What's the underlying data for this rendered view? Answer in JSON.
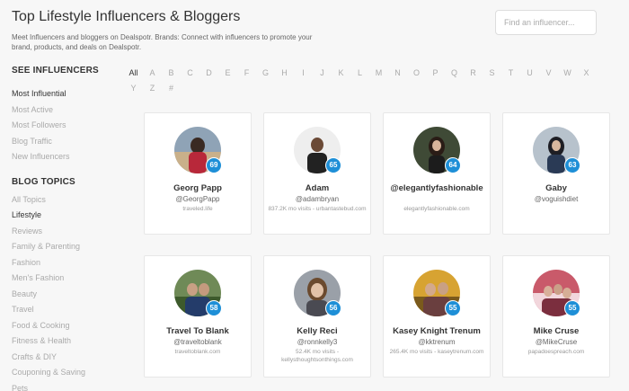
{
  "header": {
    "title": "Top Lifestyle Influencers & Bloggers",
    "description": "Meet Influencers and bloggers on Dealspotr. Brands: Connect with influencers to promote your brand, products, and deals on Dealspotr."
  },
  "search": {
    "placeholder": "Find an influencer..."
  },
  "sidebar": {
    "see_heading": "SEE INFLUENCERS",
    "filters": [
      {
        "label": "Most Influential",
        "active": true
      },
      {
        "label": "Most Active",
        "active": false
      },
      {
        "label": "Most Followers",
        "active": false
      },
      {
        "label": "Blog Traffic",
        "active": false
      },
      {
        "label": "New Influencers",
        "active": false
      }
    ],
    "topics_heading": "BLOG TOPICS",
    "topics": [
      {
        "label": "All Topics",
        "active": false
      },
      {
        "label": "Lifestyle",
        "active": true
      },
      {
        "label": "Reviews",
        "active": false
      },
      {
        "label": "Family & Parenting",
        "active": false
      },
      {
        "label": "Fashion",
        "active": false
      },
      {
        "label": "Men's Fashion",
        "active": false
      },
      {
        "label": "Beauty",
        "active": false
      },
      {
        "label": "Travel",
        "active": false
      },
      {
        "label": "Food & Cooking",
        "active": false
      },
      {
        "label": "Fitness & Health",
        "active": false
      },
      {
        "label": "Crafts & DIY",
        "active": false
      },
      {
        "label": "Couponing & Saving",
        "active": false
      },
      {
        "label": "Pets",
        "active": false
      }
    ]
  },
  "alphabet": [
    "All",
    "A",
    "B",
    "C",
    "D",
    "E",
    "F",
    "G",
    "H",
    "I",
    "J",
    "K",
    "L",
    "M",
    "N",
    "O",
    "P",
    "Q",
    "R",
    "S",
    "T",
    "U",
    "V",
    "W",
    "X",
    "Y",
    "Z",
    "#"
  ],
  "alphabet_active": "All",
  "accent_color": "#1e8fd7",
  "influencers": [
    {
      "name": "Georg Papp",
      "handle": "@GeorgPapp",
      "meta": "traveled.life",
      "score": "69"
    },
    {
      "name": "Adam",
      "handle": "@adambryan",
      "meta": "837.2K mo visits - urbantastebud.com",
      "score": "65"
    },
    {
      "name": "@elegantlyfashionable",
      "handle": "",
      "meta": "elegantlyfashionable.com",
      "score": "64"
    },
    {
      "name": "Gaby",
      "handle": "@voguishdiet",
      "meta": "",
      "score": "63"
    },
    {
      "name": "Travel To Blank",
      "handle": "@traveltoblank",
      "meta": "traveltoblank.com",
      "score": "58"
    },
    {
      "name": "Kelly Reci",
      "handle": "@ronnkelly3",
      "meta": "52.4K mo visits - kellysthoughtsonthings.com",
      "score": "56"
    },
    {
      "name": "Kasey Knight Trenum",
      "handle": "@kktrenum",
      "meta": "265.4K mo visits - kaseytrenum.com",
      "score": "55"
    },
    {
      "name": "Mike Cruse",
      "handle": "@MikeCruse",
      "meta": "papadoespreach.com",
      "score": "55"
    }
  ]
}
